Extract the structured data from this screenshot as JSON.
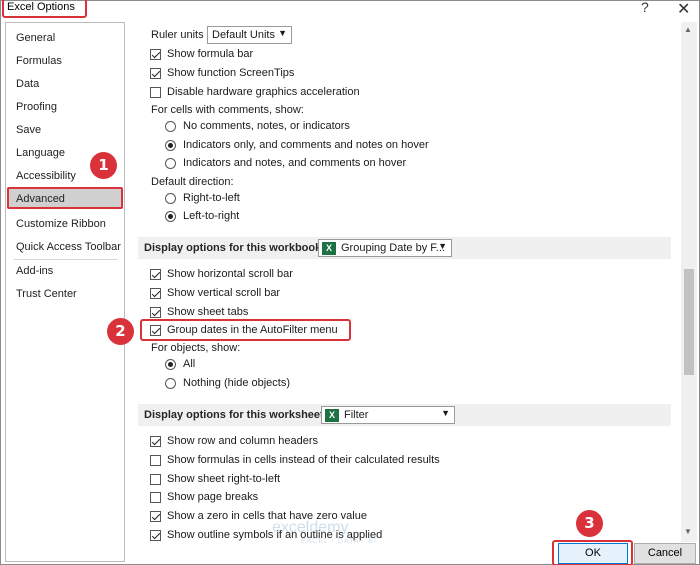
{
  "window": {
    "title": "Excel Options",
    "help_glyph": "?",
    "close_glyph": "✕"
  },
  "sidebar": {
    "items": [
      {
        "label": "General"
      },
      {
        "label": "Formulas"
      },
      {
        "label": "Data"
      },
      {
        "label": "Proofing"
      },
      {
        "label": "Save"
      },
      {
        "label": "Language"
      },
      {
        "label": "Accessibility"
      },
      {
        "label": "Advanced"
      },
      {
        "label": "Customize Ribbon"
      },
      {
        "label": "Quick Access Toolbar"
      },
      {
        "label": "Add-ins"
      },
      {
        "label": "Trust Center"
      }
    ],
    "selected": "Advanced"
  },
  "badges": {
    "one": "1",
    "two": "2",
    "three": "3"
  },
  "display": {
    "ruler_units_label": "Ruler units",
    "ruler_units_value": "Default Units",
    "show_formula_bar": "Show formula bar",
    "show_function_screentips": "Show function ScreenTips",
    "disable_hw_accel": "Disable hardware graphics acceleration",
    "comments_label": "For cells with comments, show:",
    "comments_none": "No comments, notes, or indicators",
    "comments_indicators_only": "Indicators only, and comments and notes on hover",
    "comments_indicators_and_notes": "Indicators and notes, and comments on hover",
    "direction_label": "Default direction:",
    "direction_rtl": "Right-to-left",
    "direction_ltr": "Left-to-right"
  },
  "workbook": {
    "section_label": "Display options for this workbook:",
    "selected_workbook": "Grouping Date by F...",
    "show_horizontal_scroll": "Show horizontal scroll bar",
    "show_vertical_scroll": "Show vertical scroll bar",
    "show_sheet_tabs": "Show sheet tabs",
    "group_dates": "Group dates in the AutoFilter menu",
    "objects_label": "For objects, show:",
    "objects_all": "All",
    "objects_nothing": "Nothing (hide objects)"
  },
  "worksheet": {
    "section_label": "Display options for this worksheet:",
    "selected_sheet": "Filter",
    "show_row_col_headers": "Show row and column headers",
    "show_formulas": "Show formulas in cells instead of their calculated results",
    "show_sheet_rtl": "Show sheet right-to-left",
    "show_page_breaks": "Show page breaks",
    "show_zero": "Show a zero in cells that have zero value",
    "show_outline": "Show outline symbols if an outline is applied"
  },
  "footer": {
    "ok_label": "OK",
    "cancel_label": "Cancel"
  },
  "watermark": {
    "brand": "exceldemy",
    "tagline": "EXCEL · DATA · BI"
  },
  "icons": {
    "excel_file": "X",
    "dropdown": "▼",
    "scroll_up": "▲",
    "scroll_down": "▼"
  }
}
